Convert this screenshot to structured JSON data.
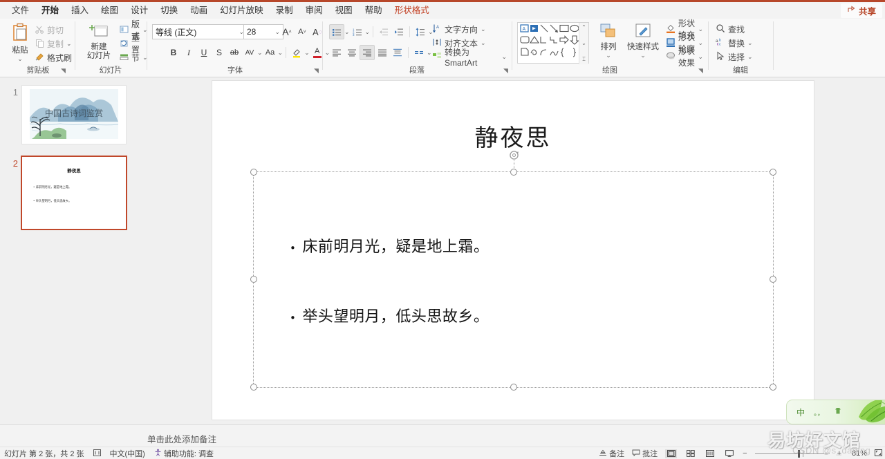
{
  "app": {
    "accent_color": "#b7472a",
    "share_label": "共享",
    "share_icon": "share-icon"
  },
  "menubar": {
    "items": [
      {
        "label": "文件",
        "state": "normal"
      },
      {
        "label": "开始",
        "state": "active"
      },
      {
        "label": "插入",
        "state": "normal"
      },
      {
        "label": "绘图",
        "state": "normal"
      },
      {
        "label": "设计",
        "state": "normal"
      },
      {
        "label": "切换",
        "state": "normal"
      },
      {
        "label": "动画",
        "state": "normal"
      },
      {
        "label": "幻灯片放映",
        "state": "normal"
      },
      {
        "label": "录制",
        "state": "normal"
      },
      {
        "label": "审阅",
        "state": "normal"
      },
      {
        "label": "视图",
        "state": "normal"
      },
      {
        "label": "帮助",
        "state": "normal"
      },
      {
        "label": "形状格式",
        "state": "accent"
      }
    ]
  },
  "ribbon": {
    "clipboard": {
      "group_label": "剪贴板",
      "paste_label": "粘贴",
      "cut_label": "剪切",
      "copy_label": "复制",
      "format_painter_label": "格式刷"
    },
    "slides": {
      "group_label": "幻灯片",
      "new_slide_label_line1": "新建",
      "new_slide_label_line2": "幻灯片",
      "layout_label": "版式",
      "reset_label": "重置",
      "section_label": "节"
    },
    "font": {
      "group_label": "字体",
      "font_name": "等线 (正文)",
      "font_size": "28",
      "grow_label": "A",
      "shrink_label": "A",
      "clear_format_label": "A",
      "bold_label": "B",
      "italic_label": "I",
      "underline_label": "U",
      "shadow_label": "S",
      "strike_label": "ab",
      "spacing_label": "AV",
      "case_label": "Aa",
      "highlight_label": "A",
      "fontcolor_label": "A"
    },
    "paragraph": {
      "group_label": "段落",
      "text_direction_label": "文字方向",
      "align_text_label": "对齐文本",
      "smartart_label": "转换为 SmartArt"
    },
    "drawing": {
      "group_label": "绘图",
      "arrange_label": "排列",
      "quick_styles_label": "快速样式",
      "shape_fill_label": "形状填充",
      "shape_outline_label": "形状轮廓",
      "shape_effects_label": "形状效果"
    },
    "editing": {
      "group_label": "编辑",
      "find_label": "查找",
      "replace_label": "替换",
      "select_label": "选择"
    }
  },
  "thumbnails": [
    {
      "number": "1",
      "title": "中国古诗词鉴赏",
      "selected": false,
      "kind": "image-slide"
    },
    {
      "number": "2",
      "title": "静夜思",
      "selected": true,
      "kind": "text-slide",
      "lines": [
        "床前明月光，疑是地上霜。",
        "举头望明月，低头思故乡。"
      ]
    }
  ],
  "slide": {
    "title": "静夜思",
    "bullets": [
      "床前明月光，疑是地上霜。",
      "举头望明月，低头思故乡。"
    ],
    "bullet_glyph": "•"
  },
  "notes": {
    "placeholder": "单击此处添加备注"
  },
  "status": {
    "slide_counter": "幻灯片 第 2 张，共 2 张",
    "language": "中文(中国)",
    "accessibility": "辅助功能: 调查",
    "notes_button": "备注",
    "comments_button": "批注",
    "zoom_level": "81%",
    "zoom_out": "−",
    "zoom_in": "+"
  },
  "ime": {
    "mode_label": "中",
    "punct_label": "。，",
    "tool_label": "ime-tool"
  },
  "watermarks": {
    "site": "易坊好文馆",
    "user": "CSDN @s_daqing"
  }
}
